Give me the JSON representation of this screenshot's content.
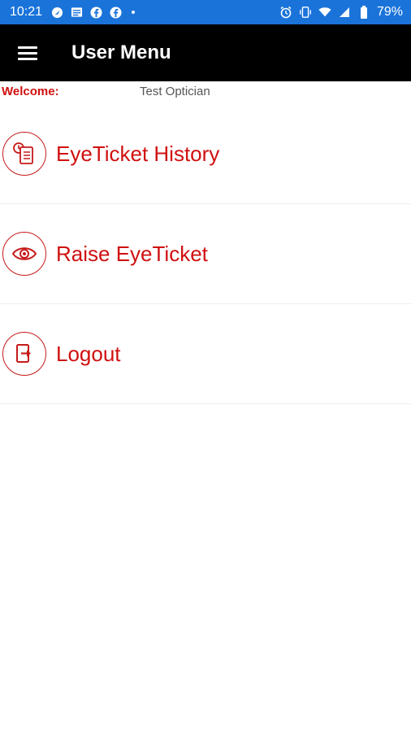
{
  "status_bar": {
    "time": "10:21",
    "battery": "79%",
    "notification_icons": [
      "navigation-icon",
      "news-icon",
      "facebook-icon",
      "facebook-icon"
    ],
    "system_icons": [
      "alarm-icon",
      "vibrate-icon",
      "wifi-icon",
      "signal-icon",
      "battery-icon"
    ]
  },
  "app_bar": {
    "title": "User Menu",
    "menu_icon": "hamburger-icon"
  },
  "welcome": {
    "label": "Welcome:",
    "name": "Test Optician"
  },
  "menu": {
    "items": [
      {
        "label": "EyeTicket History",
        "icon": "history-icon"
      },
      {
        "label": "Raise EyeTicket",
        "icon": "eye-icon"
      },
      {
        "label": "Logout",
        "icon": "logout-icon"
      }
    ]
  },
  "colors": {
    "status_bar": "#1a73d9",
    "app_bar": "#000000",
    "accent_red": "#d01010",
    "divider": "#eeeeee"
  }
}
